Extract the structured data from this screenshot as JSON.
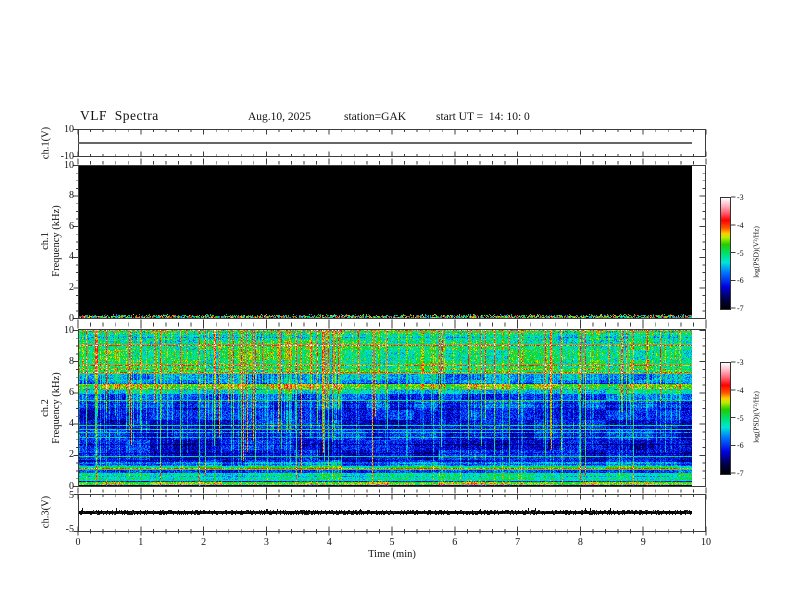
{
  "header": {
    "title": "VLF  Spectra",
    "date": "Aug.10, 2025",
    "station": "station=GAK",
    "start_ut": "start UT =  14: 10: 0"
  },
  "x_axis": {
    "label": "Time  (min)",
    "ticks": [
      "0",
      "1",
      "2",
      "3",
      "4",
      "5",
      "6",
      "7",
      "8",
      "9",
      "10"
    ]
  },
  "panels": {
    "ch1_voltage": {
      "ylabel": "ch.1(V)",
      "ticks": [
        "10",
        "-10"
      ]
    },
    "ch1_spectrogram": {
      "channel": "ch.1",
      "ylabel": "Frequency  (kHz)",
      "ticks": [
        "10",
        "8",
        "6",
        "4",
        "2",
        "0"
      ]
    },
    "ch2_spectrogram": {
      "channel": "ch.2",
      "ylabel": "Frequency  (kHz)",
      "ticks": [
        "10",
        "8",
        "6",
        "4",
        "2",
        "0"
      ]
    },
    "ch3_voltage": {
      "ylabel": "ch.3(V)",
      "ticks": [
        "5",
        "-5"
      ]
    }
  },
  "colorbar": {
    "label": "log(PSD)(V²/Hz)",
    "ticks": [
      "-3",
      "-4",
      "-5",
      "-6",
      "-7"
    ],
    "max": -3,
    "min": -7,
    "gradient": [
      [
        0.0,
        "#000000"
      ],
      [
        0.09,
        "#00004a"
      ],
      [
        0.2,
        "#0000e0"
      ],
      [
        0.33,
        "#0077ff"
      ],
      [
        0.42,
        "#00e5d8"
      ],
      [
        0.5,
        "#00e070"
      ],
      [
        0.58,
        "#22cc00"
      ],
      [
        0.645,
        "#bbee00"
      ],
      [
        0.68,
        "#ffcc00"
      ],
      [
        0.73,
        "#ff5500"
      ],
      [
        0.8,
        "#ff0000"
      ],
      [
        0.87,
        "#ff6677"
      ],
      [
        0.93,
        "#ffb3c0"
      ],
      [
        1.0,
        "#ffffff"
      ]
    ]
  },
  "chart_data": [
    {
      "panel": "ch.1 voltage",
      "type": "line",
      "xlabel": "Time (min)",
      "ylabel": "ch.1(V)",
      "xlim": [
        0,
        10
      ],
      "ylim": [
        -10,
        10
      ],
      "data_extent_min": [
        0,
        9.8
      ],
      "series": [
        {
          "name": "ch.1 waveform envelope",
          "values": "constant ≈ 0 V for entire record"
        }
      ]
    },
    {
      "panel": "ch.1 spectrogram",
      "type": "heatmap",
      "xlabel": "Time (min)",
      "ylabel": "ch.1 Frequency (kHz)",
      "xlim": [
        0,
        10
      ],
      "ylim": [
        0,
        10
      ],
      "zlabel": "log(PSD)(V²/Hz)",
      "zlim": [
        -7,
        -3
      ],
      "summary": "power at the noise floor (≈ -7, rendered black) across 0–10 kHz for the full 0–9.8 min record; only a faint broadband speckle strip below ≈0.15 kHz"
    },
    {
      "panel": "ch.2 spectrogram",
      "type": "heatmap",
      "xlabel": "Time (min)",
      "ylabel": "ch.2 Frequency (kHz)",
      "xlim": [
        0,
        10
      ],
      "ylim": [
        0,
        10
      ],
      "zlabel": "log(PSD)(V²/Hz)",
      "zlim": [
        -7,
        -3
      ],
      "summary": "broadband noise: mostly -6.5…-5.5 (blue with cyan speckle) between 1.5–6 kHz; enhanced -5…-4 (green/cyan) above ≈7 kHz; bright narrowband emission near 6.3–6.5 kHz; bright bands near 1.1–1.4 kHz and 0.4–0.9 kHz; red line near 0.15 kHz; frequent vertical broadband bursts, sporadic intense red bursts"
    },
    {
      "panel": "ch.3 voltage",
      "type": "line",
      "xlabel": "Time (min)",
      "ylabel": "ch.3(V)",
      "xlim": [
        0,
        10
      ],
      "ylim": [
        -5,
        5
      ],
      "data_extent_min": [
        0,
        9.8
      ],
      "series": [
        {
          "name": "ch.3 waveform envelope",
          "values": "thick noisy trace, constant ≈ 0 V"
        }
      ]
    }
  ]
}
